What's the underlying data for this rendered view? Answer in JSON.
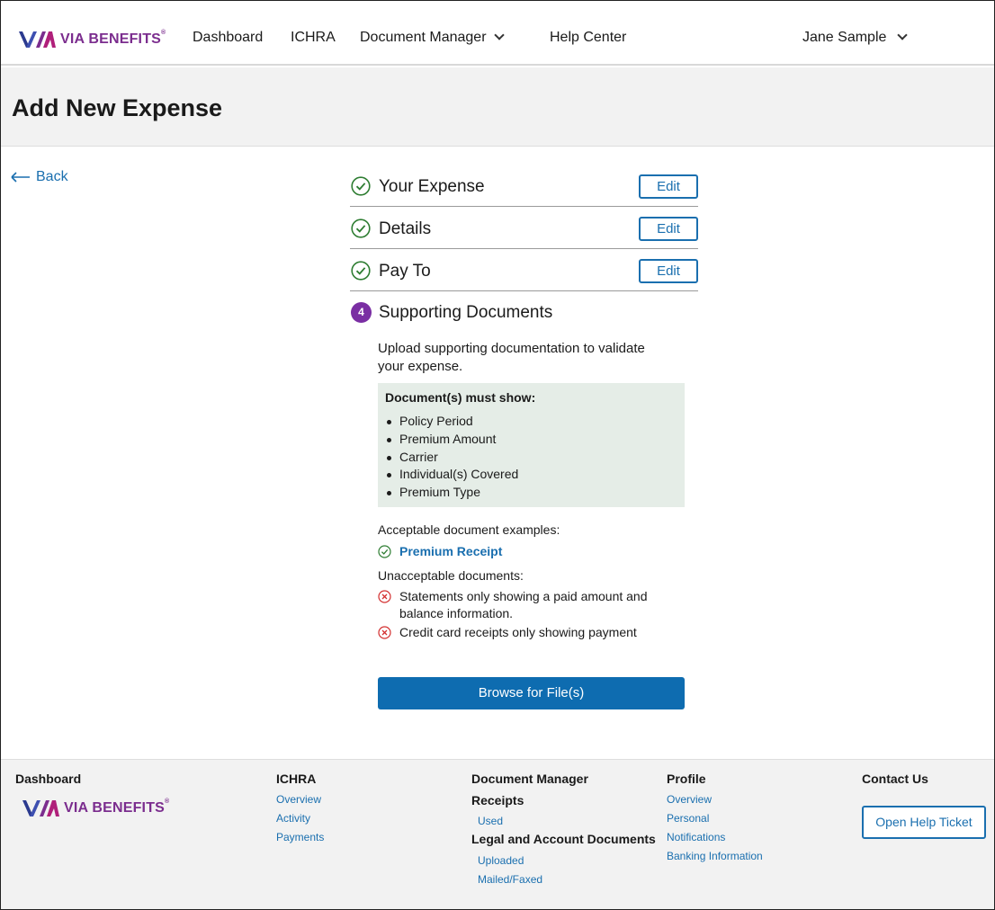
{
  "brand": {
    "name": "VIA BENEFITS",
    "colors": {
      "purple": "#7b2d8e",
      "blue": "#1a6faf",
      "step_badge": "#7a2ea3",
      "success_green": "#2e7d32",
      "error_red": "#d32f2f",
      "requirements_bg": "#e5ede7"
    }
  },
  "nav": {
    "dashboard": "Dashboard",
    "ichra": "ICHRA",
    "document_manager": "Document Manager",
    "help_center": "Help Center",
    "user_name": "Jane Sample"
  },
  "page": {
    "title": "Add New Expense",
    "back_label": "Back"
  },
  "steps": [
    {
      "label": "Your Expense",
      "status": "complete",
      "edit_label": "Edit",
      "icon": "check-circle-icon"
    },
    {
      "label": "Details",
      "status": "complete",
      "edit_label": "Edit",
      "icon": "check-circle-icon"
    },
    {
      "label": "Pay To",
      "status": "complete",
      "edit_label": "Edit",
      "icon": "check-circle-icon"
    },
    {
      "label": "Supporting Documents",
      "status": "current",
      "number": "4"
    }
  ],
  "supporting": {
    "intro": "Upload supporting documentation to validate your expense.",
    "requirements_heading": "Document(s) must show:",
    "requirements": [
      "Policy Period",
      "Premium Amount",
      "Carrier",
      "Individual(s) Covered",
      "Premium Type"
    ],
    "acceptable_heading": "Acceptable document examples:",
    "acceptable": [
      "Premium Receipt"
    ],
    "unacceptable_heading": "Unacceptable documents:",
    "unacceptable": [
      "Statements only showing a paid amount and balance information.",
      "Credit card receipts only showing payment"
    ],
    "browse_label": "Browse for File(s)"
  },
  "footer": {
    "col1": {
      "heading": "Dashboard"
    },
    "col2": {
      "heading": "ICHRA",
      "links": [
        "Overview",
        "Activity",
        "Payments"
      ]
    },
    "col3": {
      "heading": "Document Manager",
      "sub1": "Receipts",
      "sub1_links": [
        "Used"
      ],
      "sub2": "Legal and Account Documents",
      "sub2_links": [
        "Uploaded",
        "Mailed/Faxed"
      ]
    },
    "col4": {
      "heading": "Profile",
      "links": [
        "Overview",
        "Personal",
        "Notifications",
        "Banking Information"
      ]
    },
    "col5": {
      "heading": "Contact Us",
      "button": "Open Help Ticket"
    }
  }
}
